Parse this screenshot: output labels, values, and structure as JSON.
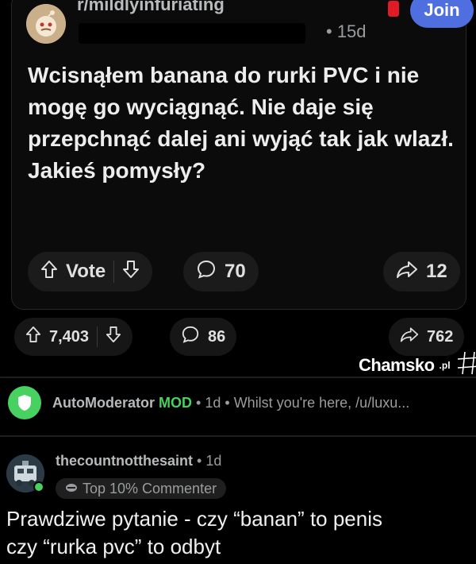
{
  "post": {
    "subreddit": "r/mildlyinfuriating",
    "age": "• 15d",
    "join_label": "Join",
    "title": "Wcisnąłem banana do rurki PVC i nie mogę go wyciągnąć. Nie daje się przepchnąć dalej ani wyjąć tak jak wlazł. Jakieś pomysły?",
    "vote_label": "Vote",
    "comments": "70",
    "shares": "12"
  },
  "outer": {
    "votes": "7,403",
    "comments": "86",
    "shares": "762"
  },
  "watermark": {
    "brand": "Chamsko",
    "suffix": ".pl"
  },
  "automod": {
    "name": "AutoModerator",
    "tag": "MOD",
    "age": "• 1d •",
    "preview": "Whilst you're here, /u/luxu..."
  },
  "comment": {
    "author": "thecountnotthesaint",
    "age": "• 1d",
    "flair": "Top 10% Commenter",
    "body_line1": "Prawdziwe pytanie - czy “banan” to penis",
    "body_line2": "czy “rurka pvc” to odbyt"
  },
  "colors": {
    "join_button": "#4f6fe0",
    "mod_green": "#46d160",
    "background": "#000000"
  }
}
